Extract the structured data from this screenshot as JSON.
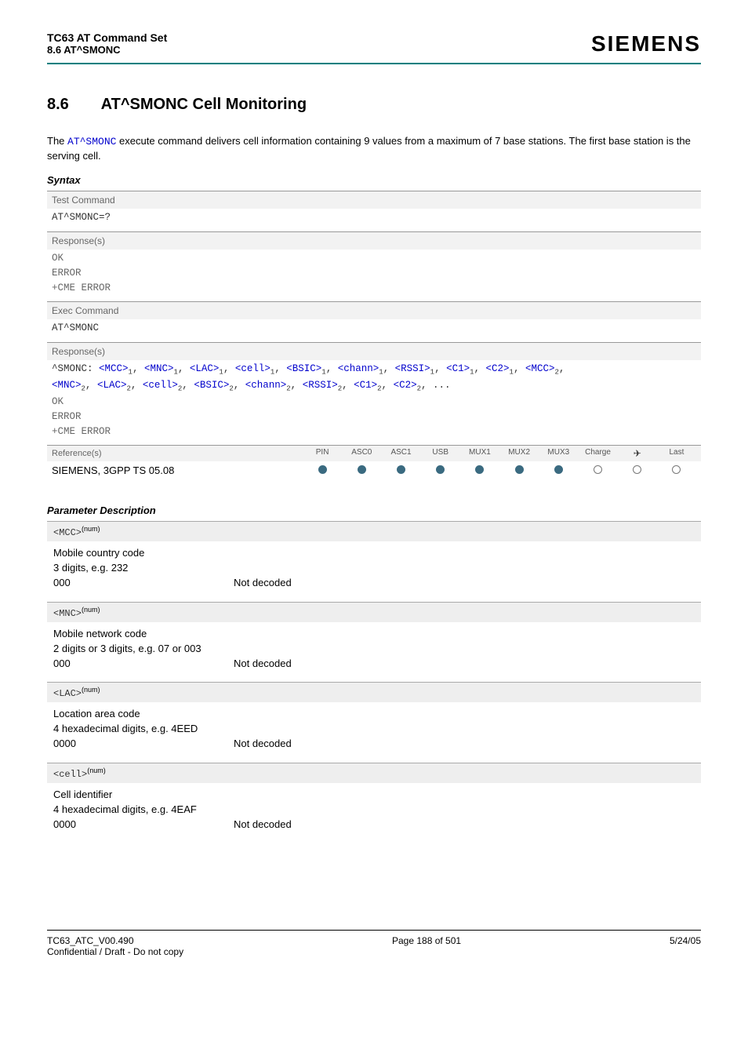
{
  "header": {
    "title": "TC63 AT Command Set",
    "subtitle": "8.6 AT^SMONC",
    "logo": "SIEMENS"
  },
  "section": {
    "number": "8.6",
    "title": "AT^SMONC   Cell Monitoring"
  },
  "intro": {
    "prefix": "The ",
    "command": "AT^SMONC",
    "rest": " execute command delivers cell information containing 9 values from a maximum of 7 base stations. The first base station is the serving cell."
  },
  "syntax": {
    "label": "Syntax",
    "test_cmd_label": "Test Command",
    "test_cmd": "AT^SMONC=?",
    "responses_label": "Response(s)",
    "test_resp": [
      "OK",
      "ERROR",
      "+CME ERROR"
    ],
    "exec_cmd_label": "Exec Command",
    "exec_cmd": "AT^SMONC",
    "exec_resp_prefix": "^SMONC: ",
    "exec_params_line1": [
      {
        "p": "<MCC>",
        "s": "1"
      },
      {
        "p": "<MNC>",
        "s": "1"
      },
      {
        "p": "<LAC>",
        "s": "1"
      },
      {
        "p": "<cell>",
        "s": "1"
      },
      {
        "p": "<BSIC>",
        "s": "1"
      },
      {
        "p": "<chann>",
        "s": "1"
      },
      {
        "p": "<RSSI>",
        "s": "1"
      },
      {
        "p": "<C1>",
        "s": "1"
      },
      {
        "p": "<C2>",
        "s": "1"
      },
      {
        "p": "<MCC>",
        "s": "2"
      }
    ],
    "exec_params_line2": [
      {
        "p": "<MNC>",
        "s": "2"
      },
      {
        "p": "<LAC>",
        "s": "2"
      },
      {
        "p": "<cell>",
        "s": "2"
      },
      {
        "p": "<BSIC>",
        "s": "2"
      },
      {
        "p": "<chann>",
        "s": "2"
      },
      {
        "p": "<RSSI>",
        "s": "2"
      },
      {
        "p": "<C1>",
        "s": "2"
      },
      {
        "p": "<C2>",
        "s": "2"
      }
    ],
    "exec_params_trailer": ", ...",
    "exec_resp_tail": [
      "OK",
      "ERROR",
      "+CME ERROR"
    ]
  },
  "reference": {
    "label": "Reference(s)",
    "text": "SIEMENS, 3GPP TS 05.08",
    "cols": [
      "PIN",
      "ASC0",
      "ASC1",
      "USB",
      "MUX1",
      "MUX2",
      "MUX3",
      "Charge",
      "✈",
      "Last"
    ],
    "dots": [
      "f",
      "f",
      "f",
      "f",
      "f",
      "f",
      "f",
      "e",
      "e",
      "e"
    ]
  },
  "param_desc_label": "Parameter Description",
  "params": [
    {
      "tag": "<MCC>",
      "sup": "(num)",
      "lines": [
        "Mobile country code",
        "3 digits, e.g. 232"
      ],
      "kv": {
        "k": "000",
        "v": "Not decoded"
      }
    },
    {
      "tag": "<MNC>",
      "sup": "(num)",
      "lines": [
        "Mobile network code",
        "2 digits or 3 digits, e.g. 07 or 003"
      ],
      "kv": {
        "k": "000",
        "v": "Not decoded"
      }
    },
    {
      "tag": "<LAC>",
      "sup": "(num)",
      "lines": [
        "Location area code",
        "4 hexadecimal digits, e.g. 4EED"
      ],
      "kv": {
        "k": "0000",
        "v": "Not decoded"
      }
    },
    {
      "tag": "<cell>",
      "sup": "(num)",
      "lines": [
        "Cell identifier",
        "4 hexadecimal digits, e.g. 4EAF"
      ],
      "kv": {
        "k": "0000",
        "v": "Not decoded"
      }
    }
  ],
  "footer": {
    "left1": "TC63_ATC_V00.490",
    "left2": "Confidential / Draft - Do not copy",
    "center": "Page 188 of 501",
    "right": "5/24/05"
  }
}
